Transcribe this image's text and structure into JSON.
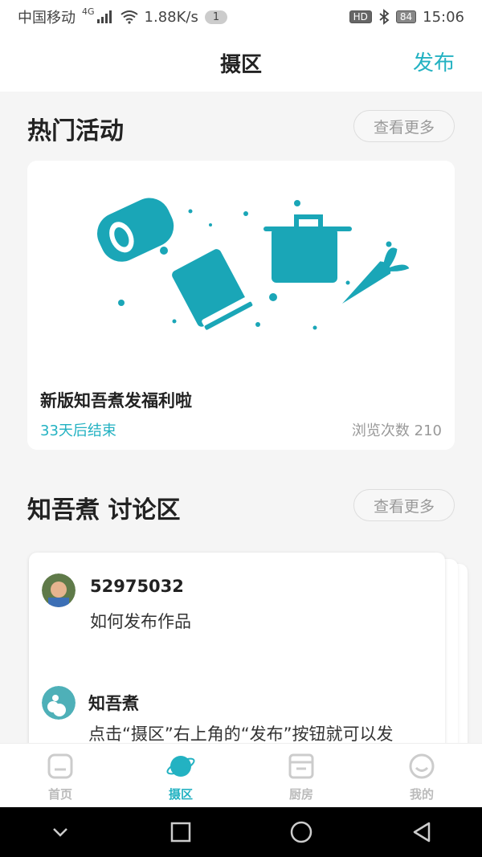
{
  "status_bar": {
    "carrier": "中国移动",
    "network": "4G",
    "speed": "1.88K/s",
    "notification_count": "1",
    "hd": "HD",
    "battery": "84",
    "time": "15:06"
  },
  "nav": {
    "title": "摄区",
    "publish": "发布"
  },
  "hot_activities": {
    "title": "热门活动",
    "more": "查看更多",
    "card": {
      "title": "新版知吾煮发福利啦",
      "ends": "33天后结束",
      "views": "浏览次数 210"
    }
  },
  "discussion": {
    "title": "知吾煮 讨论区",
    "more": "查看更多",
    "posts": [
      {
        "user": "52975032",
        "text": "如何发布作品"
      },
      {
        "user": "知吾煮",
        "text": "点击“摄区”右上角的“发布”按钮就可以发"
      }
    ]
  },
  "tabbar": {
    "items": [
      {
        "label": "首页",
        "icon": "home-icon"
      },
      {
        "label": "摄区",
        "icon": "planet-icon"
      },
      {
        "label": "厨房",
        "icon": "kitchen-icon"
      },
      {
        "label": "我的",
        "icon": "smiley-icon"
      }
    ],
    "active": "摄区"
  },
  "colors": {
    "accent": "#23b2c2",
    "illustration": "#1aa6b7"
  }
}
